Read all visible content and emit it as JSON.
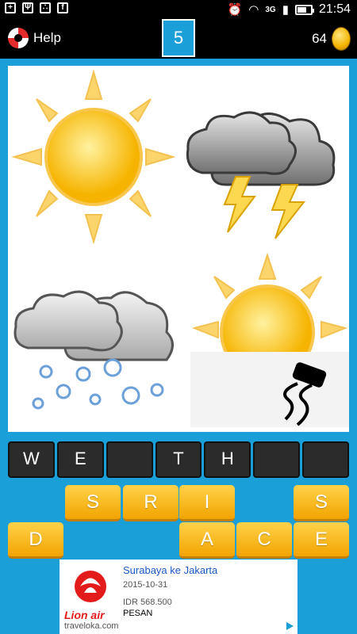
{
  "status_bar": {
    "time": "21:54",
    "network": "3G",
    "battery_level": 0.6
  },
  "header": {
    "help_label": "Help",
    "level": "5",
    "coins": "64"
  },
  "answer": {
    "slots": [
      "W",
      "E",
      "",
      "T",
      "H",
      "",
      ""
    ]
  },
  "letters": {
    "row1": [
      "",
      "S",
      "R",
      "I",
      "",
      "S"
    ],
    "row2": [
      "D",
      "",
      "",
      "A",
      "C",
      "E"
    ]
  },
  "ad": {
    "title": "Surabaya ke Jakarta",
    "date": "2015-10-31",
    "price": "IDR 568.500",
    "cta": "PESAN",
    "brand": "Lion air",
    "site": "traveloka.com"
  },
  "colors": {
    "background": "#1a9fd8",
    "tile": "#f2a400",
    "slot": "#2b2b2b"
  }
}
